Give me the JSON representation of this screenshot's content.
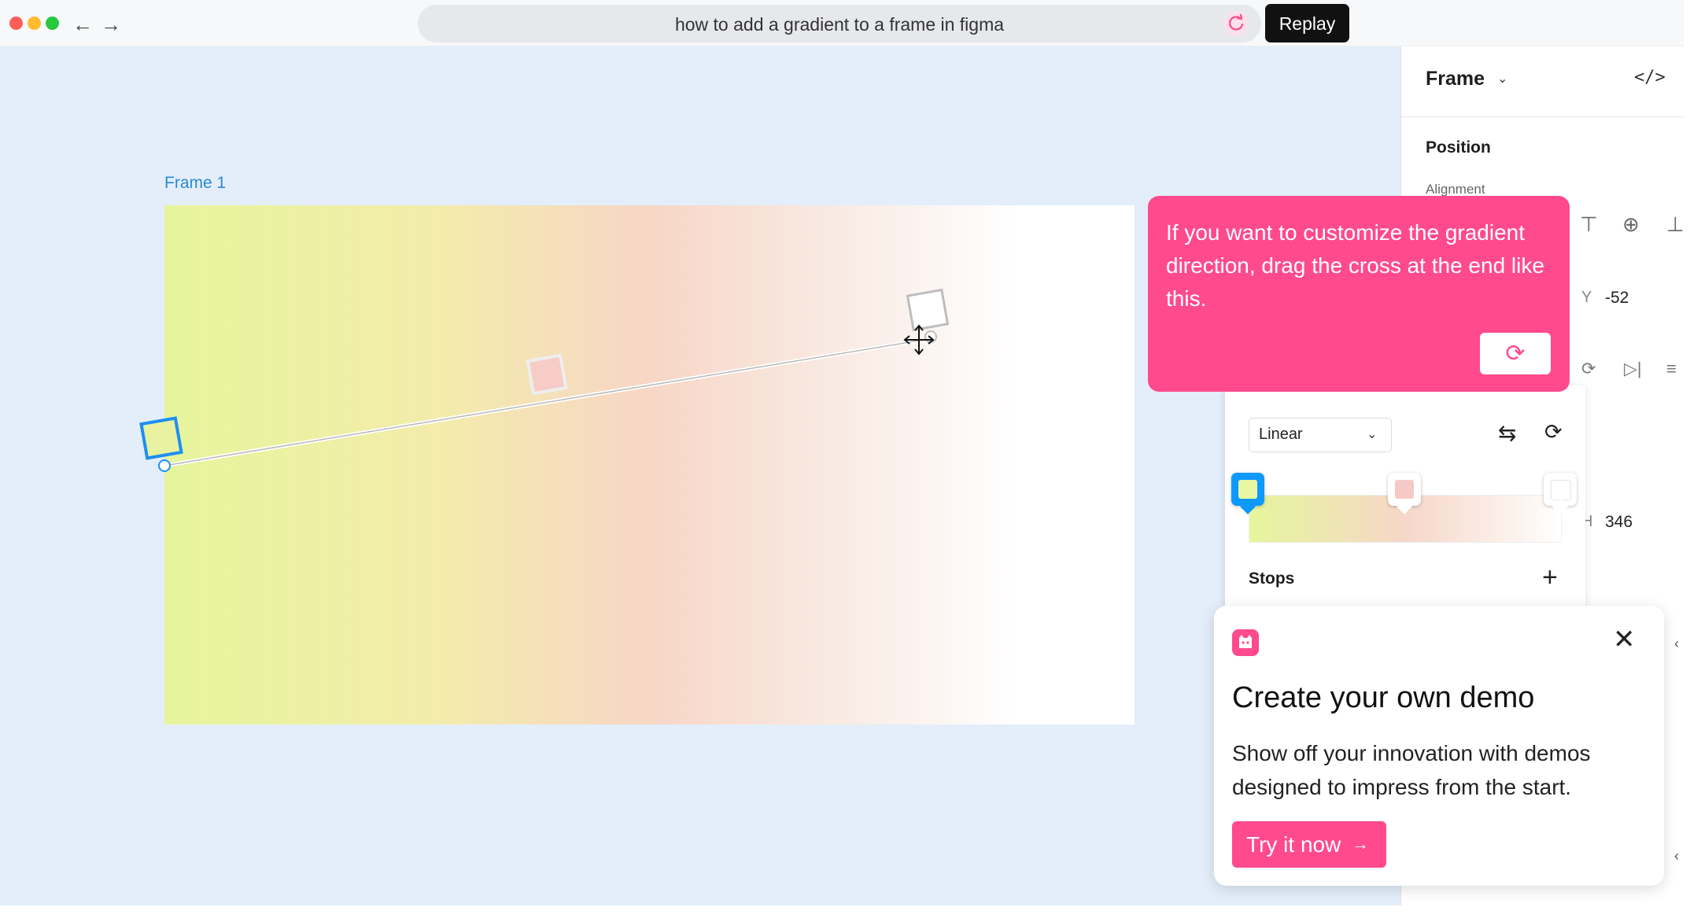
{
  "browser": {
    "search_query": "how to add a gradient to a frame in figma",
    "replay_label": "Replay",
    "window_buttons": {
      "close": "#fe5f57",
      "minimize": "#febc2e",
      "maximize": "#28c840"
    },
    "back_icon": "arrow-left-icon",
    "forward_icon": "arrow-right-icon"
  },
  "canvas": {
    "frame_label": "Frame 1",
    "gradient_colors": [
      "#e6f59c",
      "#f7d6c6",
      "#ffffff"
    ]
  },
  "panel": {
    "title": "Frame",
    "position_label": "Position",
    "alignment_label": "Alignment",
    "y_label": "Y",
    "y_value": "-52",
    "h_label": "H",
    "h_value": "346"
  },
  "gradient_editor": {
    "type_value": "Linear",
    "stops_label": "Stops",
    "stop_colors": [
      "#e9f7a4",
      "#f6c9c6",
      "#ffffff"
    ],
    "accent": "#0d99ff"
  },
  "tooltip": {
    "text": "If you want to customize the gradient direction, drag the cross at the end like this.",
    "color": "#ff4a8d"
  },
  "promo": {
    "title": "Create your own demo",
    "body": "Show off your innovation with demos designed to impress from the start.",
    "cta_label": "Try it now",
    "color": "#ff4a8d"
  }
}
